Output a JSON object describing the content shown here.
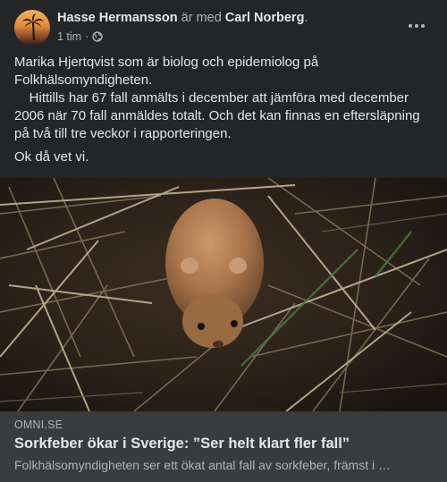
{
  "post": {
    "author": "Hasse Hermansson",
    "with_text": "är med",
    "tagged": "Carl Norberg",
    "tagged_suffix": ".",
    "time": "1 tim",
    "dot": "·",
    "audience_icon": "globe-icon",
    "more_icon": "more-horizontal-icon",
    "paragraphs": [
      "Marika Hjertqvist som är biolog och epidemiolog på Folkhälsomyndigheten.",
      "    Hittills har 67 fall anmälts i december att jämföra med december 2006 när 70 fall anmäldes totalt. Och det kan finnas en eftersläpning på två till tre veckor i rapporteringen.",
      "Ok då vet vi."
    ]
  },
  "link_preview": {
    "domain": "OMNI.SE",
    "title": "Sorkfeber ökar i Sverige: ”Ser helt klart fler fall”",
    "description": "Folkhälsomyndigheten ser ett ökat antal fall av sorkfeber, främst i …",
    "image_subject": "vole in dry grass"
  },
  "colors": {
    "background": "#242526",
    "card": "#3a3b3c",
    "text": "#e4e6eb",
    "muted": "#b0b3b8"
  }
}
